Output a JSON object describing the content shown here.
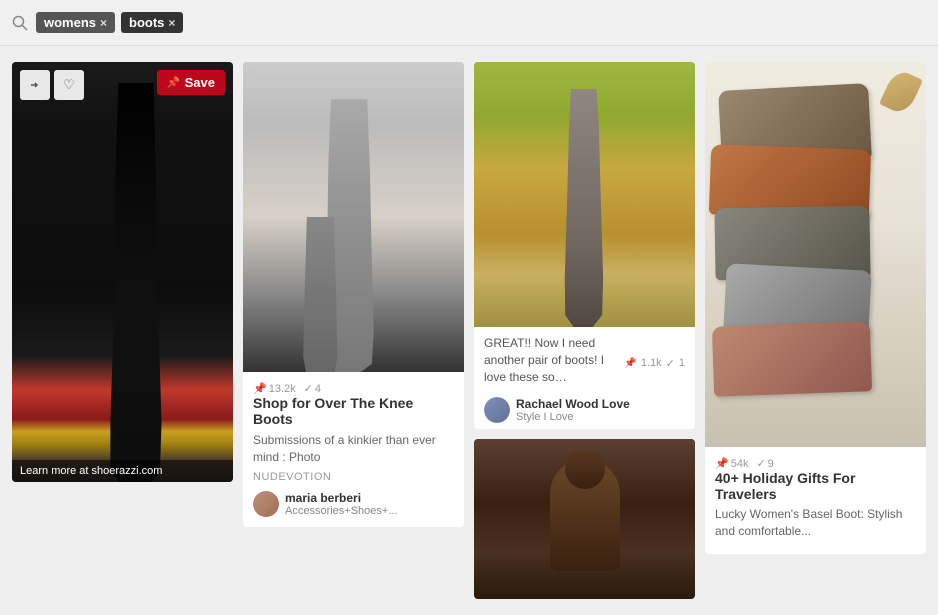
{
  "header": {
    "search_icon": "🔍",
    "tags": [
      {
        "id": "tag-womens",
        "label": "womens",
        "class": "tag-womens"
      },
      {
        "id": "tag-boots",
        "label": "boots",
        "class": "tag-boots"
      }
    ]
  },
  "pins": {
    "col1": {
      "image_alt": "Tall black leather boots",
      "footer_text": "Learn more at shoerazzi.com",
      "save_label": "Save"
    },
    "col2": {
      "image_alt": "Over the knee grey boots",
      "title": "Shop for Over The Knee Boots",
      "desc": "Submissions of a kinkier than ever mind : Photo",
      "source": "NUDEVOTION",
      "save_count": "13.2k",
      "heart_count": "4",
      "user_name": "maria berberi",
      "user_handle": "Accessories+Shoes+..."
    },
    "col3": {
      "image_alt": "Grey knee-high boots with zipper",
      "desc": "GREAT!! Now I need another pair of boots! I love these so…",
      "save_count": "1.1k",
      "heart_count": "1",
      "user_name": "Rachael Wood Love",
      "user_handle": "Style I Love",
      "card2_image_alt": "Brown hoodie"
    },
    "col4": {
      "image_alt": "Stacked ankle boots holiday gifts",
      "title": "40+ Holiday Gifts For Travelers",
      "desc": "Lucky Women's Basel Boot: Stylish and comfortable...",
      "save_count": "54k",
      "heart_count": "9"
    }
  },
  "icons": {
    "pin": "📌",
    "heart": "♡",
    "heart_filled": "♥",
    "arrow": "➤",
    "close": "×"
  }
}
